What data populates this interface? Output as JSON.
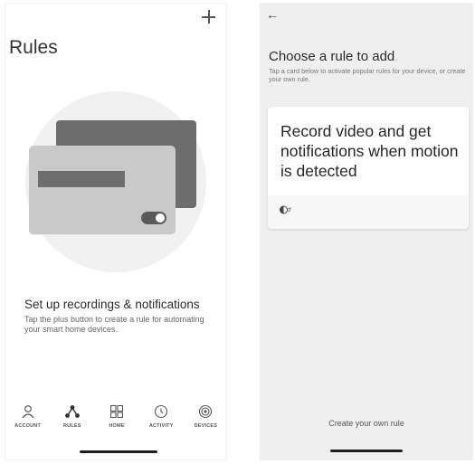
{
  "left_screen": {
    "title": "Rules",
    "add_symbol": "+",
    "empty_state": {
      "heading": "Set up recordings & notifications",
      "description": "Tap the plus button to create a rule for automating your smart home devices."
    },
    "tabs": [
      {
        "label": "ACCOUNT",
        "icon": "person-icon"
      },
      {
        "label": "RULES",
        "icon": "rules-nodes-icon"
      },
      {
        "label": "HOME",
        "icon": "grid-home-icon"
      },
      {
        "label": "ACTIVITY",
        "icon": "activity-clock-icon"
      },
      {
        "label": "DEVICES",
        "icon": "devices-target-icon"
      }
    ]
  },
  "right_screen": {
    "back_symbol": "←",
    "title": "Choose a rule to add",
    "subtitle": "Tap a card below to activate popular rules for your device, or create your own rule.",
    "rule_card": {
      "text": "Record video and get notifications when motion is detected",
      "icon": "motion-sensor-icon"
    },
    "create_own_label": "Create your own rule"
  },
  "colors": {
    "right_background": "#efefef",
    "card_back": "#6d6d6d",
    "card_front": "#c9c9c9",
    "illustration_circle": "#f1f1f1"
  }
}
